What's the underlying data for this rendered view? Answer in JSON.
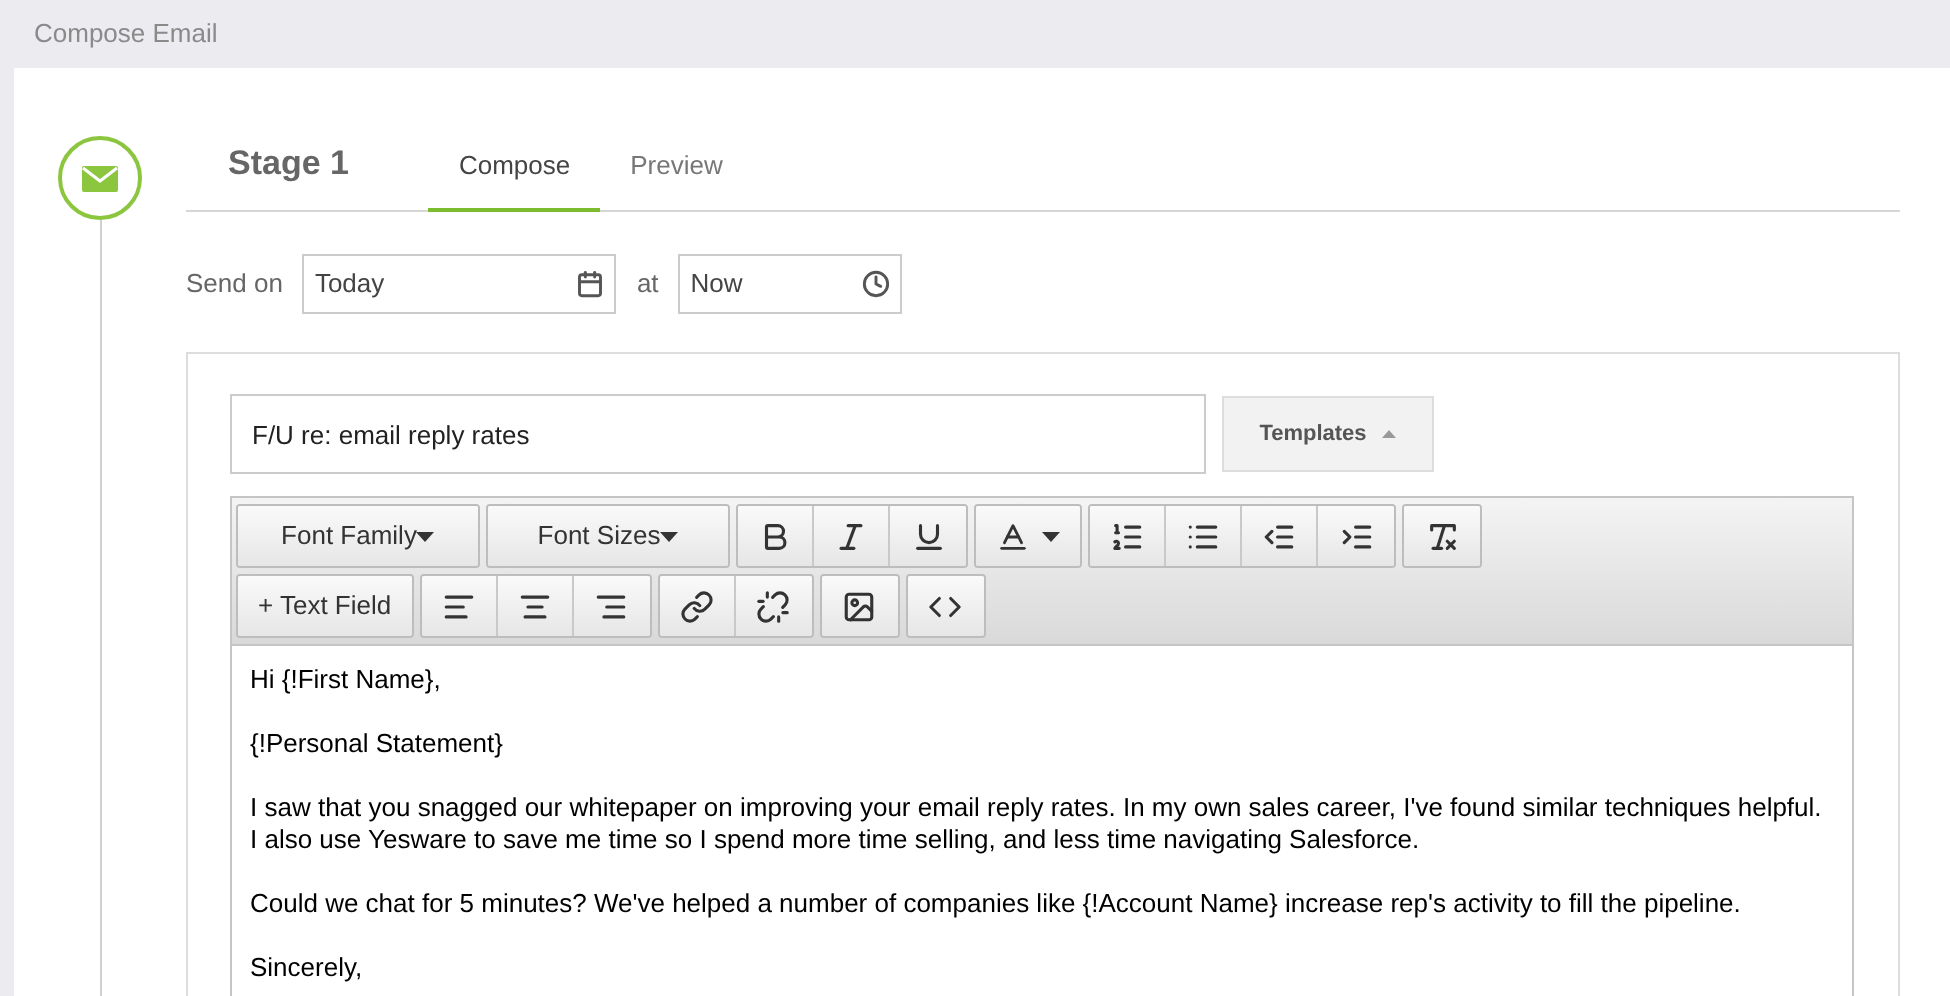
{
  "header": {
    "title": "Compose Email"
  },
  "stage": {
    "title": "Stage 1"
  },
  "tabs": [
    {
      "label": "Compose",
      "selected": true
    },
    {
      "label": "Preview",
      "selected": false
    }
  ],
  "schedule": {
    "label": "Send on",
    "date": "Today",
    "connector": "at",
    "time": "Now"
  },
  "subject": {
    "value": "F/U re: email reply rates"
  },
  "templates_button": {
    "label": "Templates"
  },
  "toolbar_rows": [
    [
      [
        {
          "kind": "dropdown",
          "label": "Font Family"
        }
      ],
      [
        {
          "kind": "dropdown",
          "label": "Font Sizes"
        }
      ],
      [
        {
          "kind": "bold"
        },
        {
          "kind": "italic"
        },
        {
          "kind": "underline"
        }
      ],
      [
        {
          "kind": "textcolor"
        }
      ],
      [
        {
          "kind": "numbered"
        },
        {
          "kind": "bullets"
        },
        {
          "kind": "outdent"
        },
        {
          "kind": "indent"
        }
      ],
      [
        {
          "kind": "clearformat"
        }
      ]
    ],
    [
      [
        {
          "kind": "textbutton",
          "label": "+ Text Field"
        }
      ],
      [
        {
          "kind": "alignleft"
        },
        {
          "kind": "aligncenter"
        },
        {
          "kind": "alignright"
        }
      ],
      [
        {
          "kind": "link"
        },
        {
          "kind": "unlink"
        }
      ],
      [
        {
          "kind": "image"
        }
      ],
      [
        {
          "kind": "code"
        }
      ]
    ]
  ],
  "body": [
    "Hi {!First Name},",
    "{!Personal Statement}",
    "I saw that you snagged our whitepaper on improving your email reply rates. In my own sales career, I've found similar techniques helpful. I also use Yesware to save me time so I spend more time selling, and less time navigating Salesforce.",
    "Could we chat for 5 minutes? We've helped a number of companies like {!Account Name} increase rep's activity to fill the pipeline.",
    "Sincerely,"
  ]
}
